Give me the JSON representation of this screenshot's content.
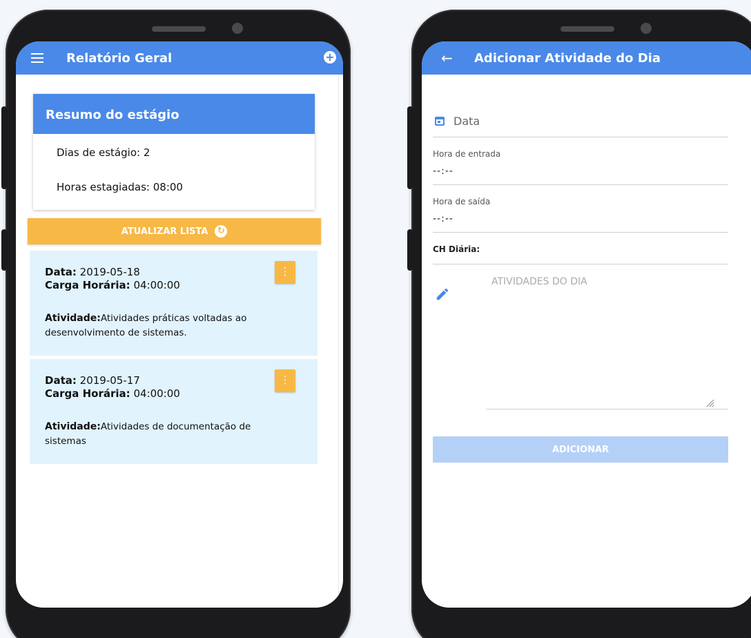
{
  "left_screen": {
    "appbar": {
      "title": "Relatório Geral"
    },
    "summary": {
      "title": "Resumo do estágio",
      "dias": "Dias de estágio: 2",
      "horas": "Horas estagiadas: 08:00"
    },
    "refresh_button": {
      "label": "ATUALIZAR LISTA"
    },
    "activities": [
      {
        "data_label": "Data:",
        "data_value": "2019-05-18",
        "carga_label": "Carga Horária:",
        "carga_value": "04:00:00",
        "atividade_label": "Atividade:",
        "atividade_value": "Atividades práticas voltadas ao desenvolvimento de sistemas."
      },
      {
        "data_label": "Data:",
        "data_value": "2019-05-17",
        "carga_label": "Carga Horária:",
        "carga_value": "04:00:00",
        "atividade_label": "Atividade:",
        "atividade_value": "Atividades de documentação de sistemas"
      }
    ]
  },
  "right_screen": {
    "appbar": {
      "title": "Adicionar Atividade do Dia"
    },
    "form": {
      "data_placeholder": "Data",
      "hora_entrada_label": "Hora de entrada",
      "hora_entrada_value": "--:--",
      "hora_saida_label": "Hora de saída",
      "hora_saida_value": "--:--",
      "ch_diaria_label": "CH Diária:",
      "atividades_placeholder": "ATIVIDADES DO DIA"
    },
    "add_button": {
      "label": "ADICIONAR"
    }
  },
  "colors": {
    "primary": "#4a89e8",
    "accent": "#f7b846",
    "card_bg": "#e1f3fd",
    "disabled_button": "#b5d0f7"
  }
}
